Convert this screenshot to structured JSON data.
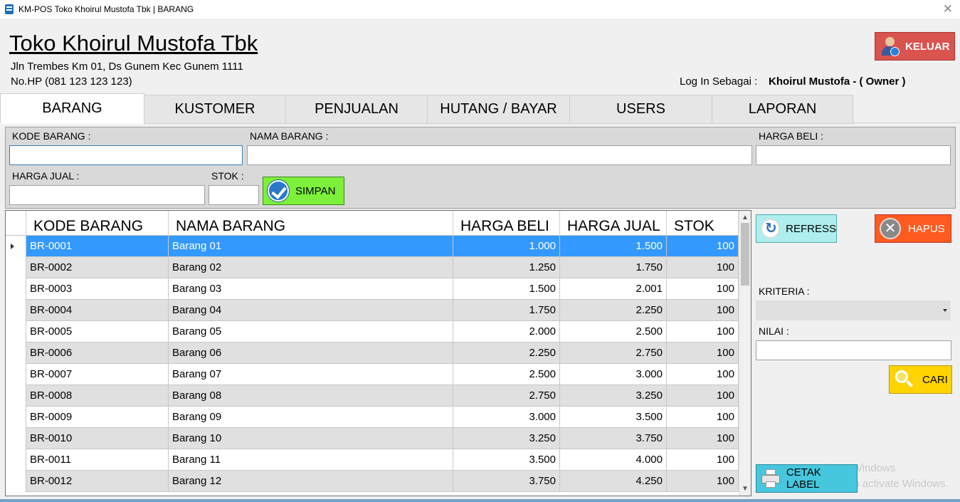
{
  "window": {
    "title": "KM-POS Toko Khoirul Mustofa Tbk | BARANG",
    "close_glyph": "✕"
  },
  "header": {
    "store_name": "Toko Khoirul Mustofa Tbk",
    "address": "Jln Trembes Km 01, Ds Gunem Kec Gunem 1111",
    "phone": "No.HP (081 123 123 123)",
    "login_label": "Log In Sebagai :",
    "login_user": "Khoirul Mustofa - ( Owner )",
    "logout_label": "KELUAR"
  },
  "tabs": [
    {
      "label": "BARANG",
      "active": true
    },
    {
      "label": "KUSTOMER",
      "active": false
    },
    {
      "label": "PENJUALAN",
      "active": false
    },
    {
      "label": "HUTANG / BAYAR",
      "active": false
    },
    {
      "label": "USERS",
      "active": false
    },
    {
      "label": "LAPORAN",
      "active": false
    }
  ],
  "form": {
    "kode_label": "KODE BARANG :",
    "kode_value": "",
    "nama_label": "NAMA BARANG :",
    "nama_value": "",
    "harga_beli_label": "HARGA BELI :",
    "harga_beli_value": "",
    "harga_jual_label": "HARGA JUAL :",
    "harga_jual_value": "",
    "stok_label": "STOK :",
    "stok_value": "",
    "save_label": "SIMPAN"
  },
  "table": {
    "columns": [
      "KODE BARANG",
      "NAMA BARANG",
      "HARGA BELI",
      "HARGA JUAL",
      "STOK"
    ],
    "rows": [
      [
        "BR-0001",
        "Barang 01",
        "1.000",
        "1.500",
        "100"
      ],
      [
        "BR-0002",
        "Barang 02",
        "1.250",
        "1.750",
        "100"
      ],
      [
        "BR-0003",
        "Barang 03",
        "1.500",
        "2.001",
        "100"
      ],
      [
        "BR-0004",
        "Barang 04",
        "1.750",
        "2.250",
        "100"
      ],
      [
        "BR-0005",
        "Barang 05",
        "2.000",
        "2.500",
        "100"
      ],
      [
        "BR-0006",
        "Barang 06",
        "2.250",
        "2.750",
        "100"
      ],
      [
        "BR-0007",
        "Barang 07",
        "2.500",
        "3.000",
        "100"
      ],
      [
        "BR-0008",
        "Barang 08",
        "2.750",
        "3.250",
        "100"
      ],
      [
        "BR-0009",
        "Barang 09",
        "3.000",
        "3.500",
        "100"
      ],
      [
        "BR-0010",
        "Barang 10",
        "3.250",
        "3.750",
        "100"
      ],
      [
        "BR-0011",
        "Barang 11",
        "3.500",
        "4.000",
        "100"
      ],
      [
        "BR-0012",
        "Barang 12",
        "3.750",
        "4.250",
        "100"
      ]
    ],
    "selected_row": 0
  },
  "side": {
    "refresh_label": "REFRESS",
    "delete_label": "HAPUS",
    "criteria_label": "KRITERIA :",
    "criteria_value": "",
    "nilai_label": "NILAI :",
    "nilai_value": "",
    "search_label": "CARI",
    "print_label": "CETAK LABEL"
  },
  "watermark": {
    "line1": "Activate Windows",
    "line2": "Go to Settings to activate Windows."
  },
  "colors": {
    "selection": "#3399ff",
    "simpan": "#7cf03a",
    "refresh": "#aeeeee",
    "hapus": "#ff5a1f",
    "keluar": "#d9534f",
    "cari": "#ffd400",
    "cetak": "#46c7de"
  }
}
